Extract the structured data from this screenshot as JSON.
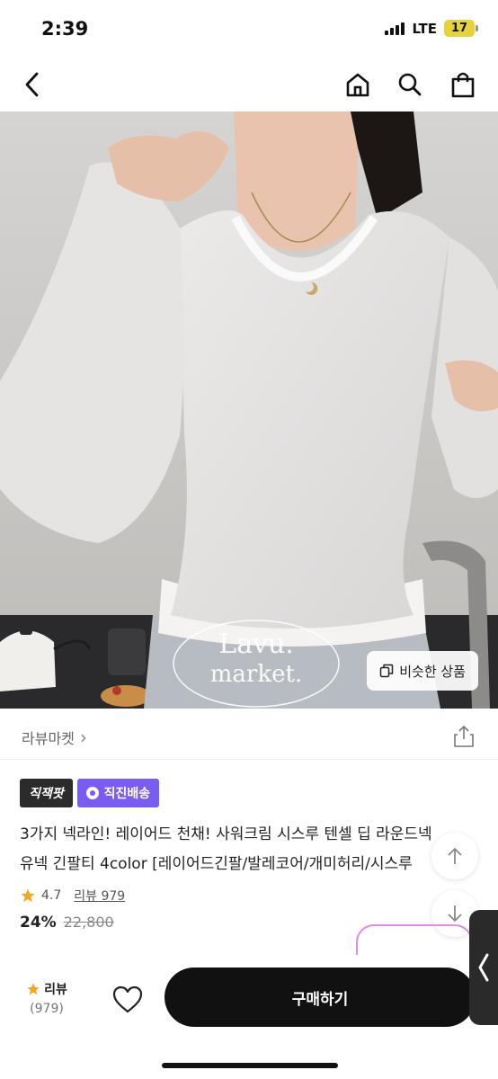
{
  "status_bar": {
    "time": "2:39",
    "network": "LTE",
    "battery": "17"
  },
  "nav": {
    "back_icon": "chevron-left-icon",
    "home_icon": "home-icon",
    "search_icon": "search-icon",
    "cart_icon": "shopping-bag-icon"
  },
  "hero": {
    "watermark_line1": "Lavu.",
    "watermark_line2": "market.",
    "similar_button_label": "비슷한 상품"
  },
  "shop": {
    "name": "라뷰마켓",
    "chevron": "›"
  },
  "badges": {
    "primary": "직잭팟",
    "delivery": "직진배송"
  },
  "product": {
    "title_line1": "3가지 넥라인! 레이어드 천채! 사워크림 시스루 텐셀 딥 라운드넥",
    "title_line2": "유넥 긴팔티 4color [레이어드긴팔/발레코어/개미허리/시스루",
    "rating": "4.7",
    "review_label": "리뷰 979"
  },
  "price": {
    "discount": "24%",
    "original": "22,800"
  },
  "bottom_bar": {
    "review_label": "리뷰",
    "review_count": "(979)",
    "buy_label": "구매하기"
  },
  "colors": {
    "accent_purple": "#7b5cf0",
    "star": "#f5a623",
    "buy_button": "#111111"
  }
}
